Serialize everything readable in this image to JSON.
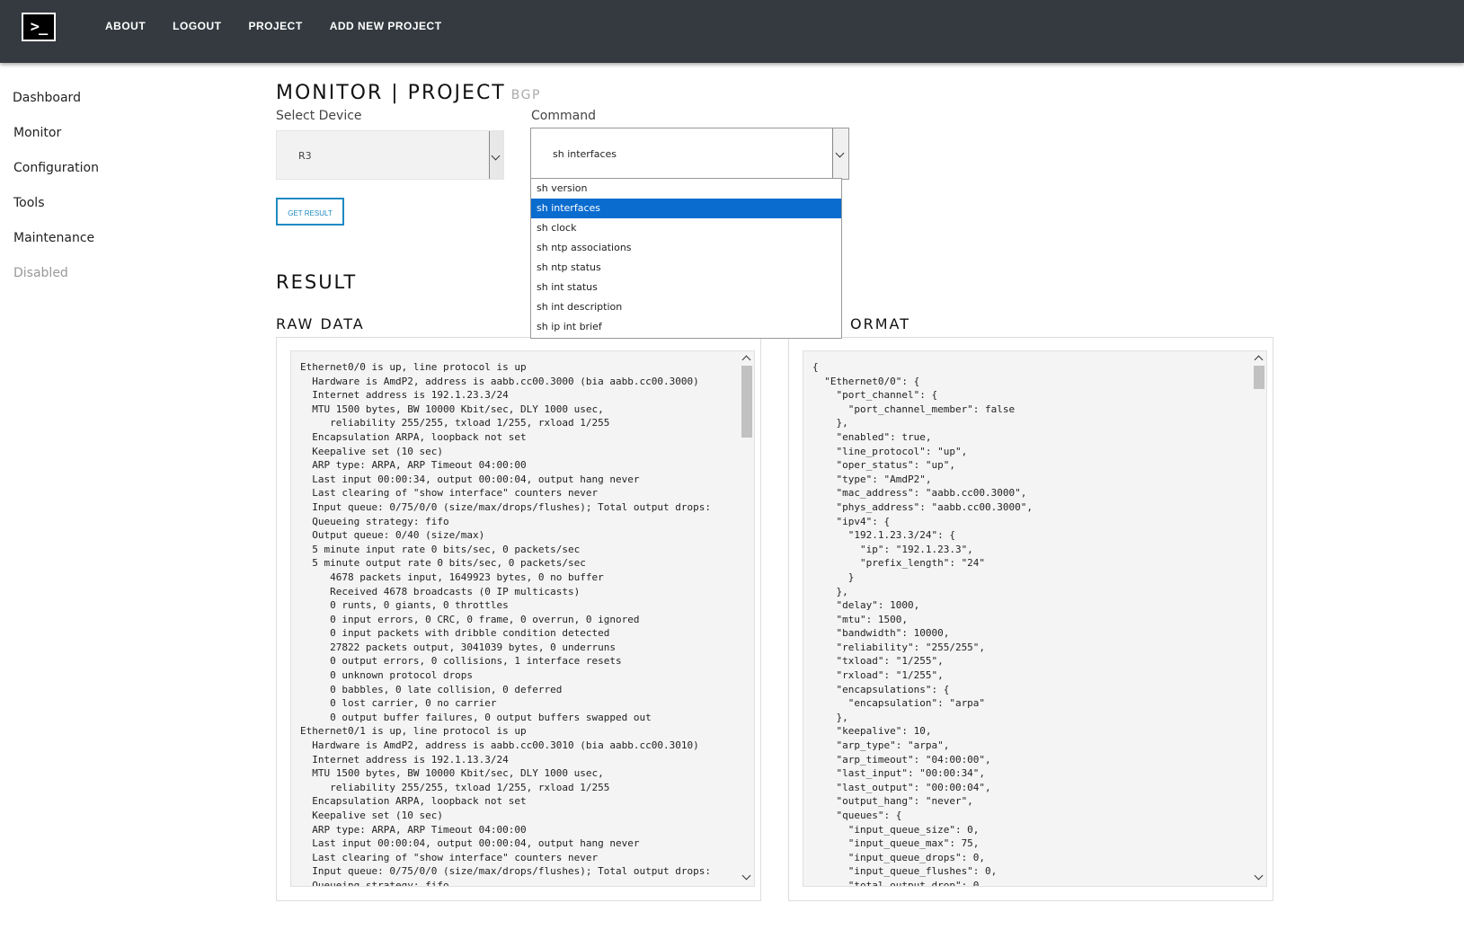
{
  "nav": {
    "logo": ">_",
    "items": [
      "ABOUT",
      "LOGOUT",
      "PROJECT",
      "ADD NEW PROJECT"
    ]
  },
  "sidebar": {
    "items": [
      {
        "label": "Dashboard",
        "disabled": false
      },
      {
        "label": "Monitor",
        "disabled": false
      },
      {
        "label": "Configuration",
        "disabled": false
      },
      {
        "label": "Tools",
        "disabled": false
      },
      {
        "label": "Maintenance",
        "disabled": false
      },
      {
        "label": "Disabled",
        "disabled": true
      }
    ]
  },
  "page": {
    "title": "MONITOR | PROJECT",
    "subtitle": "BGP"
  },
  "form": {
    "device_label": "Select Device",
    "device_value": "R3",
    "command_label": "Command",
    "command_value": "sh interfaces",
    "command_options": [
      "sh version",
      "sh interfaces",
      "sh clock",
      "sh ntp associations",
      "sh ntp status",
      "sh int status",
      "sh int description",
      "sh ip int brief"
    ],
    "command_selected_index": 1,
    "button_label": "GET RESULT"
  },
  "result": {
    "heading": "RESULT",
    "raw_heading": "RAW DATA",
    "format_heading": "ORMAT",
    "raw_text": "Ethernet0/0 is up, line protocol is up\n  Hardware is AmdP2, address is aabb.cc00.3000 (bia aabb.cc00.3000)\n  Internet address is 192.1.23.3/24\n  MTU 1500 bytes, BW 10000 Kbit/sec, DLY 1000 usec,\n     reliability 255/255, txload 1/255, rxload 1/255\n  Encapsulation ARPA, loopback not set\n  Keepalive set (10 sec)\n  ARP type: ARPA, ARP Timeout 04:00:00\n  Last input 00:00:34, output 00:00:04, output hang never\n  Last clearing of \"show interface\" counters never\n  Input queue: 0/75/0/0 (size/max/drops/flushes); Total output drops:\n  Queueing strategy: fifo\n  Output queue: 0/40 (size/max)\n  5 minute input rate 0 bits/sec, 0 packets/sec\n  5 minute output rate 0 bits/sec, 0 packets/sec\n     4678 packets input, 1649923 bytes, 0 no buffer\n     Received 4678 broadcasts (0 IP multicasts)\n     0 runts, 0 giants, 0 throttles\n     0 input errors, 0 CRC, 0 frame, 0 overrun, 0 ignored\n     0 input packets with dribble condition detected\n     27822 packets output, 3041039 bytes, 0 underruns\n     0 output errors, 0 collisions, 1 interface resets\n     0 unknown protocol drops\n     0 babbles, 0 late collision, 0 deferred\n     0 lost carrier, 0 no carrier\n     0 output buffer failures, 0 output buffers swapped out\nEthernet0/1 is up, line protocol is up\n  Hardware is AmdP2, address is aabb.cc00.3010 (bia aabb.cc00.3010)\n  Internet address is 192.1.13.3/24\n  MTU 1500 bytes, BW 10000 Kbit/sec, DLY 1000 usec,\n     reliability 255/255, txload 1/255, rxload 1/255\n  Encapsulation ARPA, loopback not set\n  Keepalive set (10 sec)\n  ARP type: ARPA, ARP Timeout 04:00:00\n  Last input 00:00:04, output 00:00:04, output hang never\n  Last clearing of \"show interface\" counters never\n  Input queue: 0/75/0/0 (size/max/drops/flushes); Total output drops:\n  Queueing strategy: fifo",
    "json_text": "{\n  \"Ethernet0/0\": {\n    \"port_channel\": {\n      \"port_channel_member\": false\n    },\n    \"enabled\": true,\n    \"line_protocol\": \"up\",\n    \"oper_status\": \"up\",\n    \"type\": \"AmdP2\",\n    \"mac_address\": \"aabb.cc00.3000\",\n    \"phys_address\": \"aabb.cc00.3000\",\n    \"ipv4\": {\n      \"192.1.23.3/24\": {\n        \"ip\": \"192.1.23.3\",\n        \"prefix_length\": \"24\"\n      }\n    },\n    \"delay\": 1000,\n    \"mtu\": 1500,\n    \"bandwidth\": 10000,\n    \"reliability\": \"255/255\",\n    \"txload\": \"1/255\",\n    \"rxload\": \"1/255\",\n    \"encapsulations\": {\n      \"encapsulation\": \"arpa\"\n    },\n    \"keepalive\": 10,\n    \"arp_type\": \"arpa\",\n    \"arp_timeout\": \"04:00:00\",\n    \"last_input\": \"00:00:34\",\n    \"last_output\": \"00:00:04\",\n    \"output_hang\": \"never\",\n    \"queues\": {\n      \"input_queue_size\": 0,\n      \"input_queue_max\": 75,\n      \"input_queue_drops\": 0,\n      \"input_queue_flushes\": 0,\n      \"total_output_drop\": 0,"
  },
  "colors": {
    "topbar": "#343a40",
    "accent": "#1e8bc3",
    "selected_option": "#0a6ccf"
  }
}
